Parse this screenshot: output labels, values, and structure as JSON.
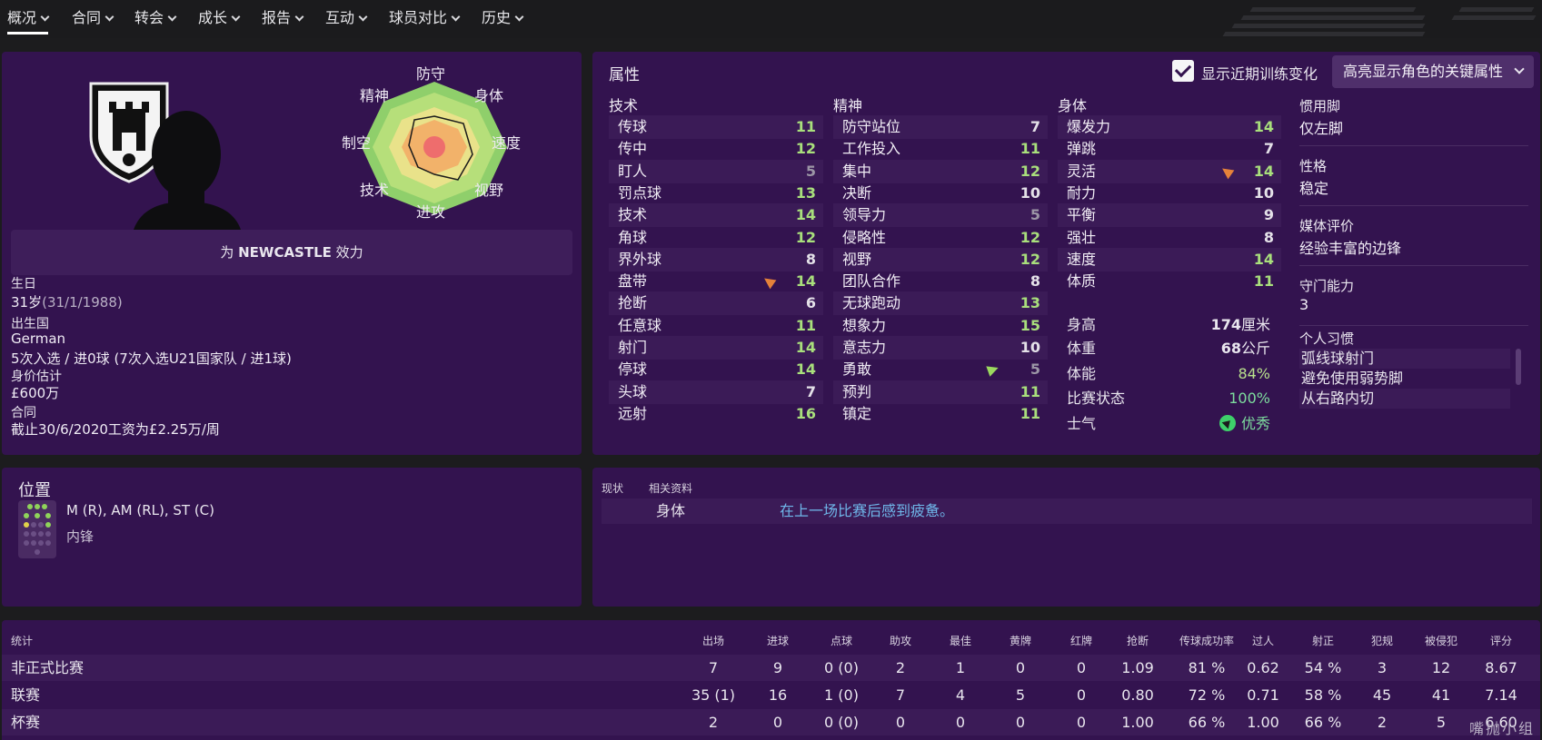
{
  "nav": {
    "tabs": [
      {
        "label": "概况",
        "has_menu": true,
        "active": true
      },
      {
        "label": "合同",
        "has_menu": true
      },
      {
        "label": "转会",
        "has_menu": true
      },
      {
        "label": "成长",
        "has_menu": true
      },
      {
        "label": "报告",
        "has_menu": true
      },
      {
        "label": "互动",
        "has_menu": true
      },
      {
        "label": "球员对比",
        "has_menu": true
      },
      {
        "label": "历史",
        "has_menu": true
      }
    ]
  },
  "profile": {
    "radar_labels": {
      "top": "防守",
      "top_right": "身体",
      "right": "速度",
      "bottom_right": "视野",
      "bottom": "进攻",
      "bottom_left": "技术",
      "left": "制空",
      "top_left": "精神"
    },
    "plays_for_prefix": "为 ",
    "plays_for_club": "NEWCASTLE",
    "plays_for_suffix": " 效力",
    "birth_label": "生日",
    "age": "31岁",
    "birth_date": "(31/1/1988)",
    "nationality_label": "出生国",
    "nationality": "German",
    "caps": "5次入选 / 进0球 (7次入选U21国家队 / 进1球)",
    "value_label": "身价估计",
    "value": "£600万",
    "contract_label": "合同",
    "contract": "截止30/6/2020工资为£2.25万/周"
  },
  "attributes": {
    "title": "属性",
    "show_training_label": "显示近期训练变化",
    "show_training_checked": true,
    "highlight_dropdown": "高亮显示角色的关键属性",
    "technical_head": "技术",
    "mental_head": "精神",
    "physical_head": "身体",
    "technical": [
      {
        "name": "传球",
        "value": 11
      },
      {
        "name": "传中",
        "value": 12
      },
      {
        "name": "盯人",
        "value": 5
      },
      {
        "name": "罚点球",
        "value": 13
      },
      {
        "name": "技术",
        "value": 14
      },
      {
        "name": "角球",
        "value": 12
      },
      {
        "name": "界外球",
        "value": 8
      },
      {
        "name": "盘带",
        "value": 14,
        "trend": "down"
      },
      {
        "name": "抢断",
        "value": 6
      },
      {
        "name": "任意球",
        "value": 11
      },
      {
        "name": "射门",
        "value": 14
      },
      {
        "name": "停球",
        "value": 14
      },
      {
        "name": "头球",
        "value": 7
      },
      {
        "name": "远射",
        "value": 16
      }
    ],
    "mental": [
      {
        "name": "防守站位",
        "value": 7
      },
      {
        "name": "工作投入",
        "value": 11
      },
      {
        "name": "集中",
        "value": 12
      },
      {
        "name": "决断",
        "value": 10
      },
      {
        "name": "领导力",
        "value": 5
      },
      {
        "name": "侵略性",
        "value": 12
      },
      {
        "name": "视野",
        "value": 12
      },
      {
        "name": "团队合作",
        "value": 8
      },
      {
        "name": "无球跑动",
        "value": 13
      },
      {
        "name": "想象力",
        "value": 15
      },
      {
        "name": "意志力",
        "value": 10
      },
      {
        "name": "勇敢",
        "value": 5,
        "trend": "up"
      },
      {
        "name": "预判",
        "value": 11
      },
      {
        "name": "镇定",
        "value": 11
      }
    ],
    "physical": [
      {
        "name": "爆发力",
        "value": 14
      },
      {
        "name": "弹跳",
        "value": 7
      },
      {
        "name": "灵活",
        "value": 14,
        "trend": "down"
      },
      {
        "name": "耐力",
        "value": 10
      },
      {
        "name": "平衡",
        "value": 9
      },
      {
        "name": "强壮",
        "value": 8
      },
      {
        "name": "速度",
        "value": 14
      },
      {
        "name": "体质",
        "value": 11
      }
    ],
    "body": [
      {
        "name": "身高",
        "value": "174",
        "unit": "厘米"
      },
      {
        "name": "体重",
        "value": "68",
        "unit": "公斤"
      },
      {
        "name": "体能",
        "value": "84%"
      },
      {
        "name": "比赛状态",
        "value": "100%"
      },
      {
        "name": "士气",
        "value": "优秀"
      }
    ],
    "side": {
      "foot_label": "惯用脚",
      "foot": "仅左脚",
      "personality_label": "性格",
      "personality": "稳定",
      "media_label": "媒体评价",
      "media": "经验丰富的边锋",
      "gk_label": "守门能力",
      "gk": "3",
      "habits_label": "个人习惯",
      "habits": [
        "弧线球射门",
        "避免使用弱势脚",
        "从右路内切"
      ]
    }
  },
  "position": {
    "title": "位置",
    "positions": "M (R), AM (RL), ST (C)",
    "role": "内锋"
  },
  "status": {
    "tab_current": "现状",
    "tab_related": "相关资料",
    "row_label": "身体",
    "row_text": "在上一场比赛后感到疲惫。"
  },
  "stats": {
    "headers": [
      "统计",
      "出场",
      "进球",
      "点球",
      "助攻",
      "最佳",
      "黄牌",
      "红牌",
      "抢断",
      "传球成功率",
      "过人",
      "射正",
      "犯规",
      "被侵犯",
      "评分"
    ],
    "rows": [
      {
        "name": "非正式比赛",
        "values": [
          "7",
          "9",
          "0 (0)",
          "2",
          "1",
          "0",
          "0",
          "1.09",
          "81 %",
          "0.62",
          "54 %",
          "3",
          "12",
          "8.67"
        ]
      },
      {
        "name": "联赛",
        "values": [
          "35 (1)",
          "16",
          "1 (0)",
          "7",
          "4",
          "5",
          "0",
          "0.80",
          "72 %",
          "0.71",
          "58 %",
          "45",
          "41",
          "7.14"
        ]
      },
      {
        "name": "杯赛",
        "values": [
          "2",
          "0",
          "0 (0)",
          "0",
          "0",
          "0",
          "0",
          "1.00",
          "66 %",
          "1.00",
          "66 %",
          "2",
          "5",
          "6.60"
        ]
      }
    ]
  },
  "watermark": "嘴抛小组"
}
